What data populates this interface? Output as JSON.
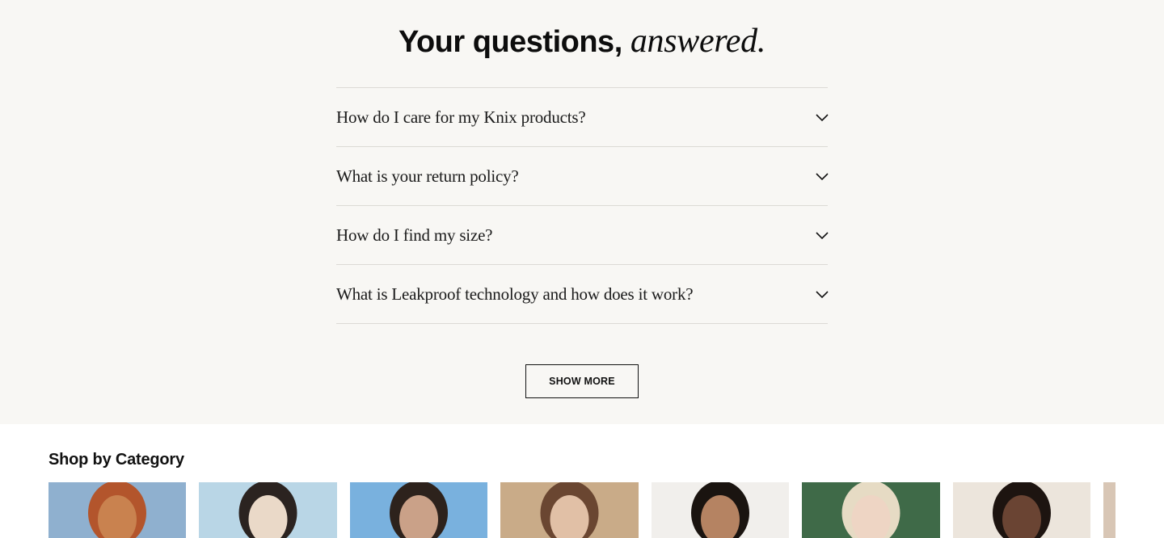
{
  "faq": {
    "title_main": "Your questions, ",
    "title_accent": "answered.",
    "questions": [
      "How do I care for my Knix products?",
      "What is your return policy?",
      "How do I find my size?",
      "What is Leakproof technology and how does it work?"
    ],
    "show_more_label": "SHOW MORE"
  },
  "shop": {
    "title": "Shop by Category",
    "cards": [
      {
        "name": "category-card-1",
        "bg": "#8fb0cf",
        "figure": "#c9824f",
        "hair": "#b3552c"
      },
      {
        "name": "category-card-2",
        "bg": "#b9d6e6",
        "figure": "#ead9c8",
        "hair": "#2b2320"
      },
      {
        "name": "category-card-3",
        "bg": "#79b1de",
        "figure": "#caa188",
        "hair": "#2d221c"
      },
      {
        "name": "category-card-4",
        "bg": "#c9ab88",
        "figure": "#e1c0a6",
        "hair": "#6a4631"
      },
      {
        "name": "category-card-5",
        "bg": "#f1efec",
        "figure": "#b58362",
        "hair": "#1a1410"
      },
      {
        "name": "category-card-6",
        "bg": "#3f6a48",
        "figure": "#eed5c4",
        "hair": "#e6dbc4"
      },
      {
        "name": "category-card-7",
        "bg": "#ece5dc",
        "figure": "#6a4433",
        "hair": "#1d1410"
      },
      {
        "name": "category-card-8",
        "bg": "#d8c6b5",
        "figure": "#c99a7a",
        "hair": "#6d4b35"
      }
    ]
  },
  "icons": {
    "chevron": "chevron-down-icon"
  },
  "colors": {
    "faq_background": "#f8f7f4",
    "divider": "#dcdad5",
    "text": "#111111"
  }
}
